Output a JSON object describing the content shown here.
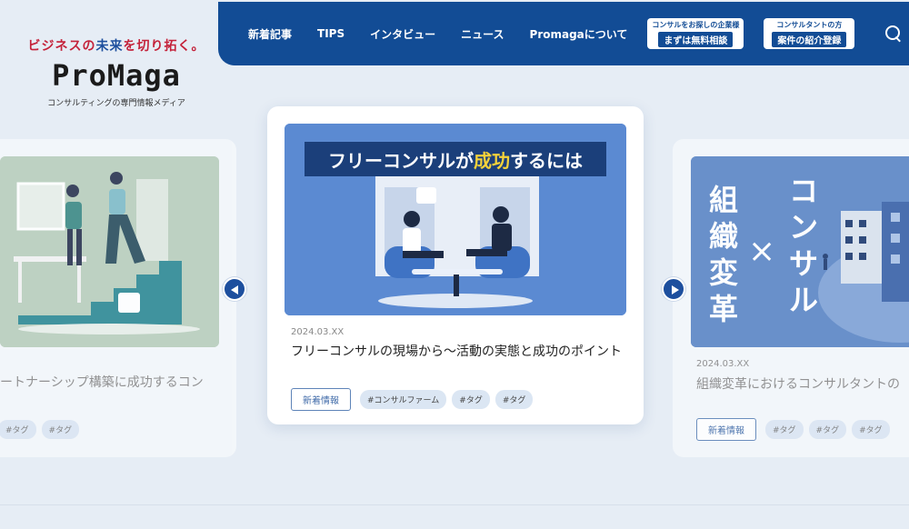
{
  "logo": {
    "tagline_red": "ビジネスの",
    "tagline_blue": "未来",
    "tagline_red2": "を切り拓く。",
    "wordmark": "ProMaga",
    "subtitle": "コンサルティングの専門情報メディア"
  },
  "nav": {
    "items": [
      "新着記事",
      "TIPS",
      "インタビュー",
      "ニュース",
      "Promagaについて"
    ],
    "cta1": {
      "small": "コンサルをお探しの企業様",
      "big": "まずは無料相談"
    },
    "cta2": {
      "small": "コンサルタントの方",
      "big": "案件の紹介登録"
    },
    "search_icon": "search-icon"
  },
  "cards": {
    "left": {
      "title": "ートナーシップ構築に成功するコン",
      "tags": [
        "#タグ",
        "#タグ"
      ]
    },
    "center": {
      "banner": "フリーコンサルが成功するには",
      "banner_pre": "フリーコンサルが",
      "banner_hl": "成功",
      "banner_post": "するには",
      "date": "2024.03.XX",
      "title": "フリーコンサルの現場から〜活動の実態と成功のポイント",
      "badge": "新着情報",
      "tags": [
        "#コンサルファーム",
        "#タグ",
        "#タグ"
      ]
    },
    "right": {
      "banner_left": "組織変革",
      "banner_x": "×",
      "banner_right": "コンサル",
      "date": "2024.03.XX",
      "title": "組織変革におけるコンサルタントの",
      "badge": "新着情報",
      "tags": [
        "#タグ",
        "#タグ",
        "#タグ"
      ]
    }
  },
  "colors": {
    "nav_bg": "#124c95",
    "accent_red": "#c4223a",
    "page_bg": "#e6edf5",
    "highlight_yellow": "#f5d23a"
  }
}
